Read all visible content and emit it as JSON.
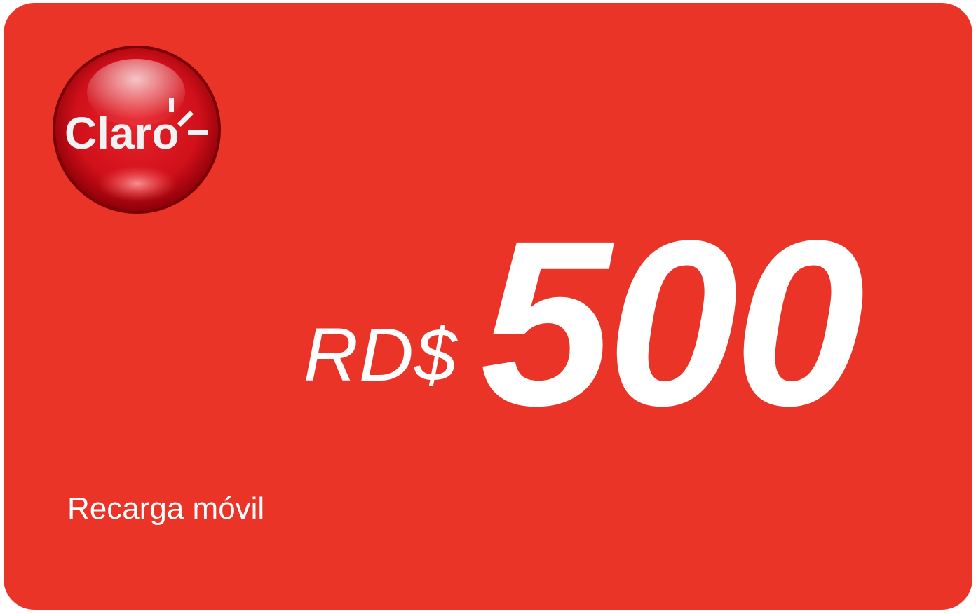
{
  "card": {
    "background_color": "#ea3428",
    "text_color": "#ffffff"
  },
  "logo": {
    "brand": "Claro",
    "icon": "claro-logo-icon",
    "sphere_color": "#d8141b"
  },
  "price": {
    "currency": "RD$",
    "amount": "500"
  },
  "caption": "Recarga móvil"
}
